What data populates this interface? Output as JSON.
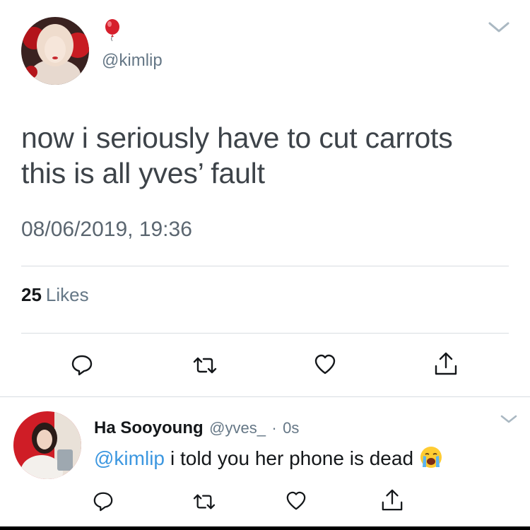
{
  "tweet": {
    "balloon_icon": "red-balloon-icon",
    "handle": "@kimlip",
    "text_line1": "now i seriously have to cut carrots",
    "text_line2": "this is all yves’ fault",
    "timestamp": "08/06/2019, 19:36",
    "likes_count": "25",
    "likes_label": "Likes"
  },
  "reply": {
    "name": "Ha Sooyoung",
    "handle": "@yves_",
    "separator": "·",
    "time": "0s",
    "mention": "@kimlip",
    "text": "i told you her phone is dead",
    "emoji": "loudly-crying-face-icon"
  },
  "colors": {
    "link_blue": "#3c97e0",
    "muted_gray": "#657786",
    "balloon_red": "#d61f2c"
  }
}
